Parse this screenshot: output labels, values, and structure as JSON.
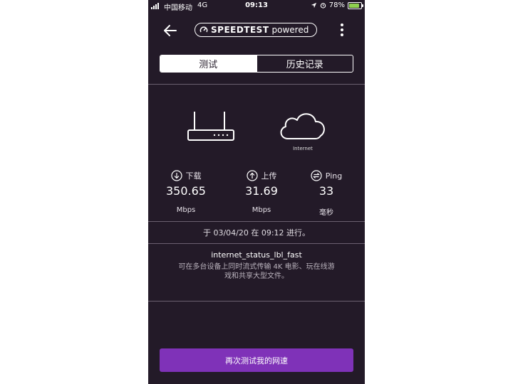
{
  "status_bar": {
    "carrier": "中国移动",
    "network": "4G",
    "time": "09:13",
    "battery": "78%",
    "icons": [
      "signal-icon",
      "location-icon",
      "alarm-icon",
      "battery-icon"
    ]
  },
  "header": {
    "back_icon": "arrow-left-icon",
    "logo_brand": "SPEEDTEST",
    "logo_suffix": "powered",
    "menu_icon": "more-vertical-icon"
  },
  "tabs": [
    {
      "label": "测试",
      "active": true
    },
    {
      "label": "历史记录",
      "active": false
    }
  ],
  "connection": {
    "router_icon": "router-icon",
    "cloud_icon": "cloud-icon",
    "cloud_label": "Internet"
  },
  "metrics": [
    {
      "icon": "download-icon",
      "label": "下载",
      "value": "350.65",
      "unit": "Mbps"
    },
    {
      "icon": "upload-icon",
      "label": "上传",
      "value": "31.69",
      "unit": "Mbps"
    },
    {
      "icon": "ping-icon",
      "label": "Ping",
      "value": "33",
      "unit": "毫秒"
    }
  ],
  "result": {
    "timestamp": "于 03/04/20 在 09:12 进行。",
    "status_title": "internet_status_lbl_fast",
    "status_desc": "可在多台设备上同时流式传输 4K 电影、玩在线游戏和共享大型文件。"
  },
  "retest_button": "再次测试我的网速",
  "colors": {
    "background": "#231a28",
    "accent": "#7f32b8",
    "divider": "#6b6070"
  }
}
